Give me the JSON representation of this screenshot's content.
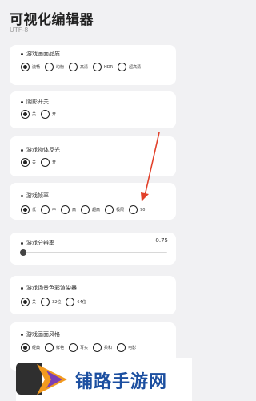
{
  "header": {
    "title": "可视化编辑器",
    "subtitle": "UTF-8"
  },
  "sections": [
    {
      "title": "游戏画面品质",
      "options": [
        "流畅",
        "均衡",
        "高清",
        "HDR",
        "超高清"
      ],
      "selected": 0
    },
    {
      "title": "阴影开关",
      "options": [
        "关",
        "开"
      ],
      "selected": 0
    },
    {
      "title": "游戏物体反光",
      "options": [
        "关",
        "开"
      ],
      "selected": 0
    },
    {
      "title": "游戏帧率",
      "options": [
        "低",
        "中",
        "高",
        "超高",
        "极限",
        "90"
      ],
      "selected": 0
    },
    {
      "title": "游戏分辨率",
      "slider_value": "0.75",
      "slider_fraction": 0.0
    },
    {
      "title": "游戏场景色彩渲染器",
      "options": [
        "关",
        "32位",
        "64位"
      ],
      "selected": 0
    },
    {
      "title": "游戏画面风格",
      "options": [
        "经典",
        "鲜艳",
        "写实",
        "柔和",
        "电影"
      ],
      "selected": 0
    }
  ],
  "watermark": {
    "text": "铺路手游网",
    "colors": {
      "text": "#1c4fa0",
      "logo_orange": "#f29a1f",
      "logo_purple": "#7b3fb5"
    }
  },
  "annotation": {
    "arrow_color": "#e2402a"
  }
}
